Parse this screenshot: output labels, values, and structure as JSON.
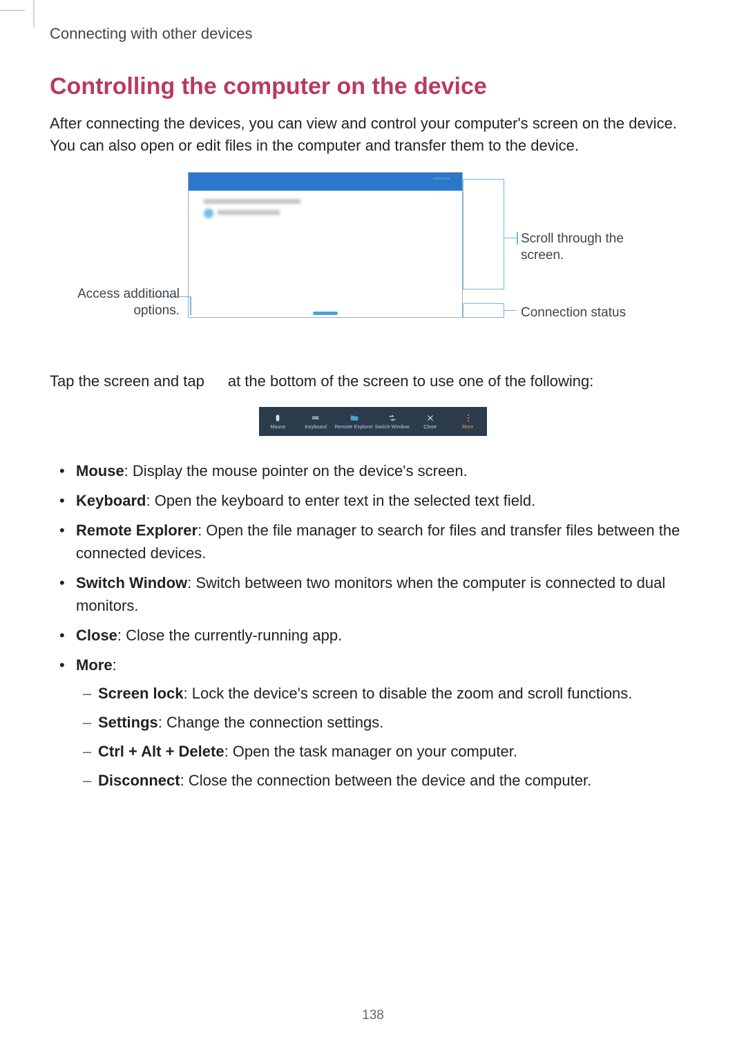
{
  "chapter": "Connecting with other devices",
  "section_title": "Controlling the computer on the device",
  "intro": "After connecting the devices, you can view and control your computer's screen on the device. You can also open or edit files in the computer and transfer them to the device.",
  "fig1": {
    "callout_scroll": "Scroll through the screen.",
    "callout_connection": "Connection status",
    "callout_options": "Access additional options."
  },
  "tap_line_pre": "Tap the screen and tap",
  "tap_line_post": "at the bottom of the screen to use one of the following:",
  "toolbar": {
    "mouse": "Mouse",
    "keyboard": "Keyboard",
    "remote_explorer": "Remote Explorer",
    "switch_window": "Switch Window",
    "close": "Close",
    "more": "More"
  },
  "items": {
    "mouse_term": "Mouse",
    "mouse_desc": ": Display the mouse pointer on the device's screen.",
    "keyboard_term": "Keyboard",
    "keyboard_desc": ": Open the keyboard to enter text in the selected text field.",
    "remote_term": "Remote Explorer",
    "remote_desc": ": Open the file manager to search for files and transfer files between the connected devices.",
    "switch_term": "Switch Window",
    "switch_desc": ": Switch between two monitors when the computer is connected to dual monitors.",
    "close_term": "Close",
    "close_desc": ": Close the currently-running app.",
    "more_term": "More",
    "more_desc": ":",
    "screen_lock_term": "Screen lock",
    "screen_lock_desc": ": Lock the device's screen to disable the zoom and scroll functions.",
    "settings_term": "Settings",
    "settings_desc": ": Change the connection settings.",
    "cad_term": "Ctrl + Alt + Delete",
    "cad_desc": ": Open the task manager on your computer.",
    "disconnect_term": "Disconnect",
    "disconnect_desc": ": Close the connection between the device and the computer."
  },
  "page_number": "138"
}
